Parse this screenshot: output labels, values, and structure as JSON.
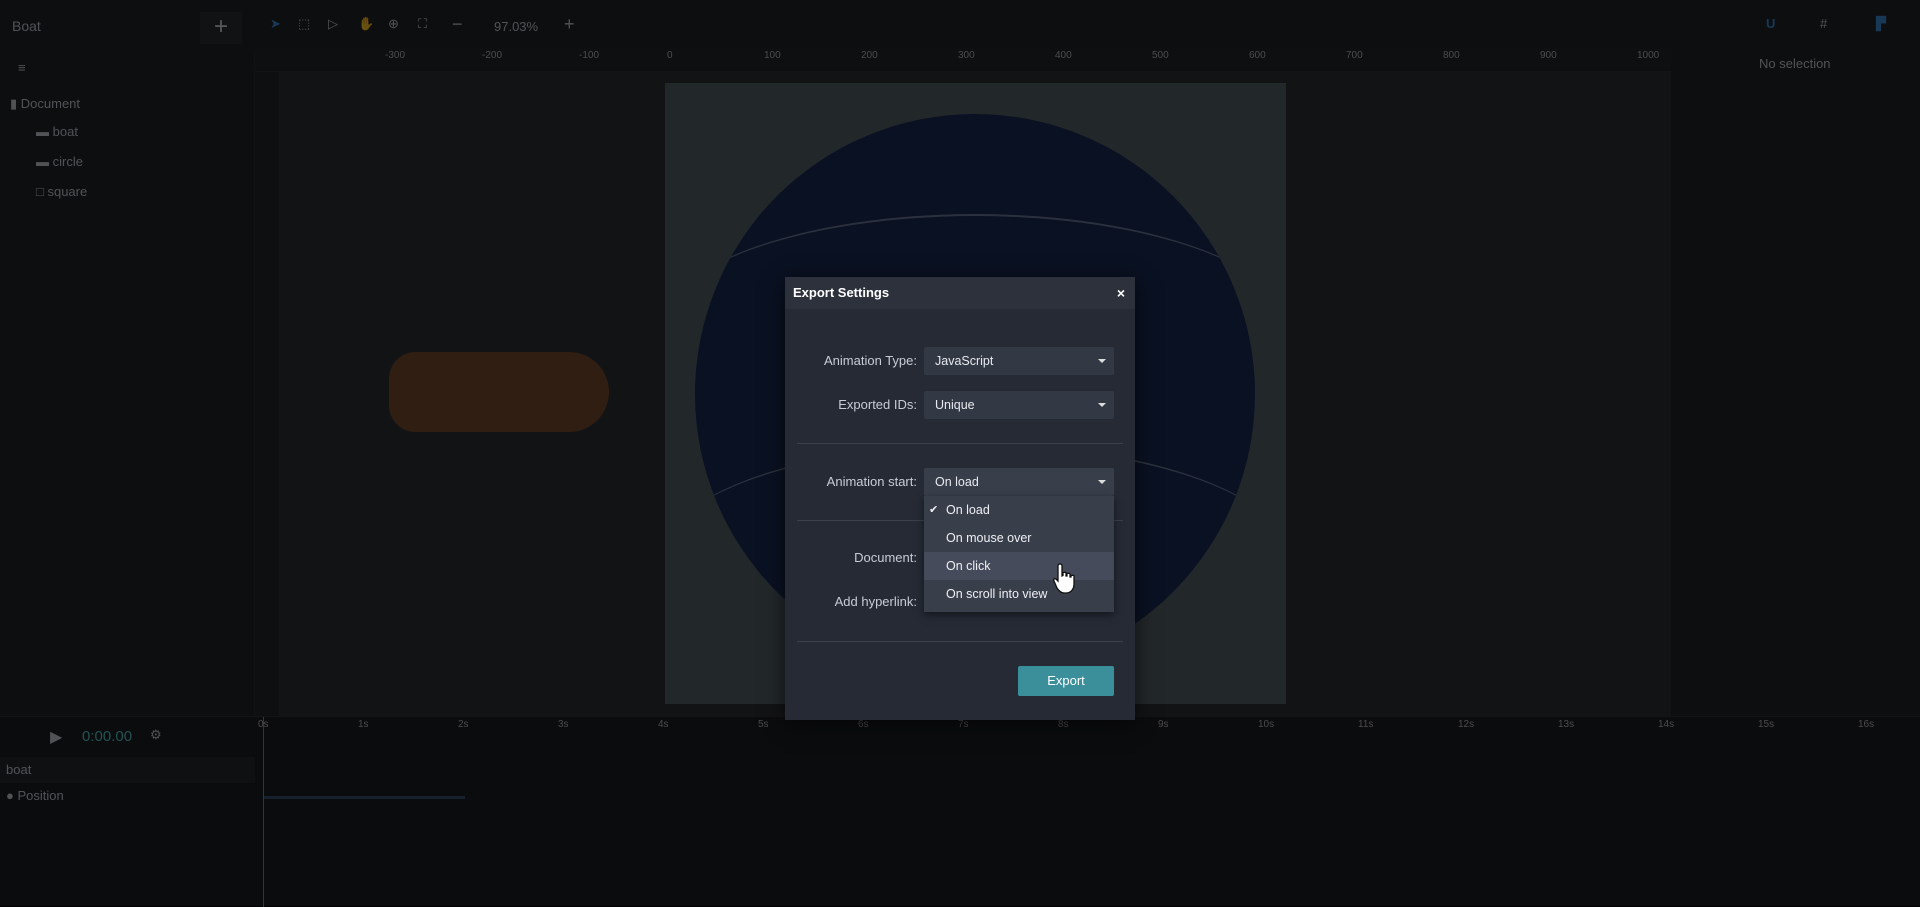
{
  "app": {
    "project_name": "Boat",
    "zoom_level": "97.03%",
    "no_selection": "No selection"
  },
  "layers": {
    "root": "Document",
    "items": [
      {
        "name": "boat",
        "icon": "folder-icon"
      },
      {
        "name": "circle",
        "icon": "folder-icon"
      },
      {
        "name": "square",
        "icon": "square-icon"
      }
    ]
  },
  "ruler": {
    "top": [
      "-300",
      "-200",
      "-100",
      "0",
      "100",
      "200",
      "300",
      "400",
      "500",
      "600",
      "700",
      "800",
      "900",
      "1000"
    ]
  },
  "timeline": {
    "time": "0:00.00",
    "seconds": [
      "0s",
      "1s",
      "2s",
      "3s",
      "4s",
      "5s",
      "6s",
      "7s",
      "8s",
      "9s",
      "10s",
      "11s",
      "12s",
      "13s",
      "14s",
      "15s",
      "16s"
    ],
    "group": "boat",
    "property": "Position"
  },
  "dialog": {
    "title": "Export Settings",
    "close": "×",
    "animation_type": {
      "label": "Animation Type:",
      "value": "JavaScript"
    },
    "exported_ids": {
      "label": "Exported IDs:",
      "value": "Unique"
    },
    "animation_start": {
      "label": "Animation start:",
      "value": "On load",
      "options": [
        "On load",
        "On mouse over",
        "On click",
        "On scroll into view"
      ],
      "selected": "On load",
      "hovered": "On click"
    },
    "document": {
      "label": "Document:"
    },
    "add_hyperlink": {
      "label": "Add hyperlink:"
    },
    "export_label": "Export"
  },
  "colors": {
    "accent": "#3a8f9a",
    "dialog_bg": "#262a35"
  }
}
